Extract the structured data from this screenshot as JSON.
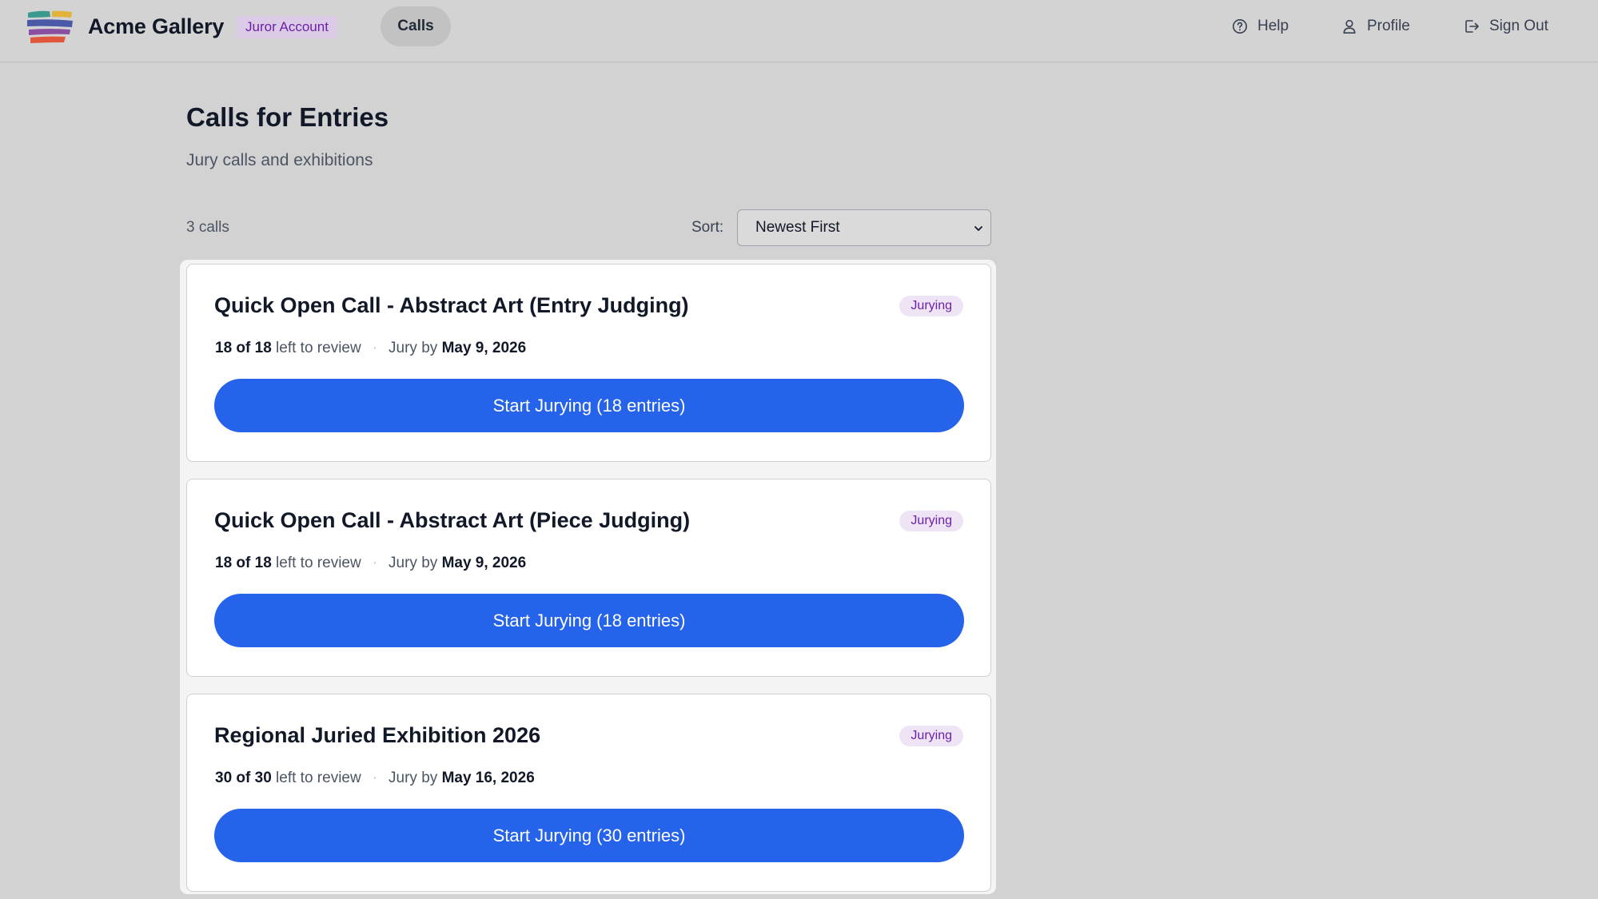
{
  "header": {
    "brand": "Acme Gallery",
    "role_badge": "Juror Account",
    "nav_calls": "Calls",
    "help": "Help",
    "profile": "Profile",
    "sign_out": "Sign Out"
  },
  "page": {
    "title": "Calls for Entries",
    "subtitle": "Jury calls and exhibitions",
    "count": "3 calls",
    "sort_label": "Sort:",
    "sort_value": "Newest First"
  },
  "calls": [
    {
      "title": "Quick Open Call - Abstract Art (Entry Judging)",
      "status": "Jurying",
      "remaining": "18 of 18",
      "remaining_suffix": "left to review",
      "jury_by_label": "Jury by",
      "jury_by_date": "May 9, 2026",
      "button": "Start Jurying (18 entries)"
    },
    {
      "title": "Quick Open Call - Abstract Art (Piece Judging)",
      "status": "Jurying",
      "remaining": "18 of 18",
      "remaining_suffix": "left to review",
      "jury_by_label": "Jury by",
      "jury_by_date": "May 9, 2026",
      "button": "Start Jurying (18 entries)"
    },
    {
      "title": "Regional Juried Exhibition 2026",
      "status": "Jurying",
      "remaining": "30 of 30",
      "remaining_suffix": "left to review",
      "jury_by_label": "Jury by",
      "jury_by_date": "May 16, 2026",
      "button": "Start Jurying (30 entries)"
    }
  ],
  "colors": {
    "primary_button": "#2563eb",
    "badge_text": "#6b21a8",
    "badge_bg": "#efe4f5",
    "page_bg": "#d2d2d2"
  },
  "icons": {
    "logo": "stacked-brush-strokes-logo",
    "help": "question-circle-icon",
    "profile": "user-icon",
    "sign_out": "sign-out-icon",
    "sort": "chevron-down-icon"
  }
}
